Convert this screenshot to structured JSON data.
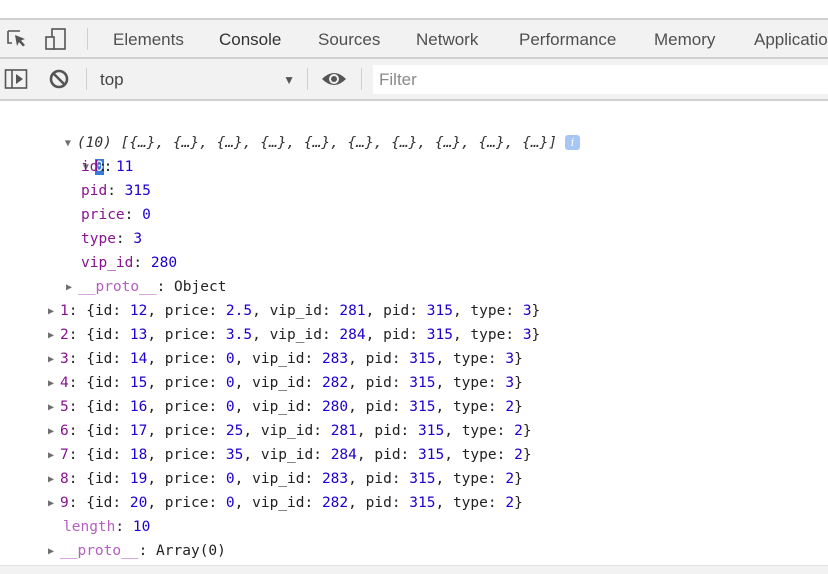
{
  "devtools": {
    "tabs": [
      {
        "label": "Elements",
        "active": false
      },
      {
        "label": "Console",
        "active": true
      },
      {
        "label": "Sources",
        "active": false
      },
      {
        "label": "Network",
        "active": false
      },
      {
        "label": "Performance",
        "active": false
      },
      {
        "label": "Memory",
        "active": false
      },
      {
        "label": "Application",
        "active": false
      }
    ],
    "icons": {
      "inspect": "inspect-element-icon",
      "device": "device-toolbar-icon",
      "sidebar": "show-sidebar-icon",
      "clear": "clear-console-icon",
      "eye": "live-expression-icon"
    },
    "accent_color": "#1a9be6"
  },
  "toolbar": {
    "context": "top",
    "filter_placeholder": "Filter",
    "filter_value": ""
  },
  "console": {
    "array_summary": "(10) [{…}, {…}, {…}, {…}, {…}, {…}, {…}, {…}, {…}, {…}]",
    "expanded_index": "0",
    "expanded_item": [
      {
        "key": "id",
        "value": "11"
      },
      {
        "key": "pid",
        "value": "315"
      },
      {
        "key": "price",
        "value": "0"
      },
      {
        "key": "type",
        "value": "3"
      },
      {
        "key": "vip_id",
        "value": "280"
      }
    ],
    "item_proto": {
      "key": "__proto__",
      "value": "Object"
    },
    "items": [
      {
        "index": "1",
        "id": "12",
        "price": "2.5",
        "vip_id": "281",
        "pid": "315",
        "type": "3"
      },
      {
        "index": "2",
        "id": "13",
        "price": "3.5",
        "vip_id": "284",
        "pid": "315",
        "type": "3"
      },
      {
        "index": "3",
        "id": "14",
        "price": "0",
        "vip_id": "283",
        "pid": "315",
        "type": "3"
      },
      {
        "index": "4",
        "id": "15",
        "price": "0",
        "vip_id": "282",
        "pid": "315",
        "type": "3"
      },
      {
        "index": "5",
        "id": "16",
        "price": "0",
        "vip_id": "280",
        "pid": "315",
        "type": "2"
      },
      {
        "index": "6",
        "id": "17",
        "price": "25",
        "vip_id": "281",
        "pid": "315",
        "type": "2"
      },
      {
        "index": "7",
        "id": "18",
        "price": "35",
        "vip_id": "284",
        "pid": "315",
        "type": "2"
      },
      {
        "index": "8",
        "id": "19",
        "price": "0",
        "vip_id": "283",
        "pid": "315",
        "type": "2"
      },
      {
        "index": "9",
        "id": "20",
        "price": "0",
        "vip_id": "282",
        "pid": "315",
        "type": "2"
      }
    ],
    "length": {
      "key": "length",
      "value": "10"
    },
    "array_proto": {
      "key": "__proto__",
      "value": "Array(0)"
    },
    "colors": {
      "key": "#881391",
      "number": "#1c00cf",
      "selection": "#3879d9"
    }
  }
}
